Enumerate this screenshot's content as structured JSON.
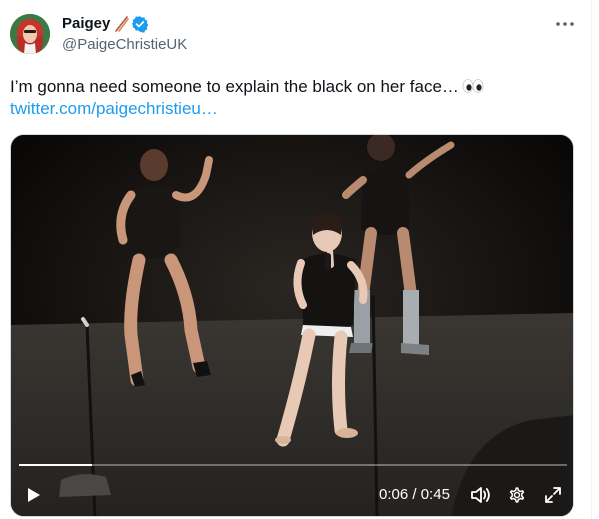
{
  "tweet": {
    "display_name": "Paigey",
    "name_emoji": "chopsticks-emoji-icon",
    "verified": true,
    "handle": "@PaigeChristieUK",
    "text": "I’m gonna need someone to explain the black on her face…",
    "text_emoji": "eyes-emoji-icon",
    "link": "twitter.com/paigechristieu…"
  },
  "video": {
    "current_time": "0:06",
    "separator": " / ",
    "duration": "0:45",
    "progress_fraction": 0.133
  },
  "colors": {
    "link": "#1d9bf0",
    "verified": "#1d9bf0",
    "text": "#0f1419",
    "secondary_text": "#536471"
  },
  "icons": {
    "more": "more-horizontal-icon",
    "play": "play-icon",
    "volume": "volume-icon",
    "settings": "settings-gear-icon",
    "fullscreen": "fullscreen-icon"
  }
}
